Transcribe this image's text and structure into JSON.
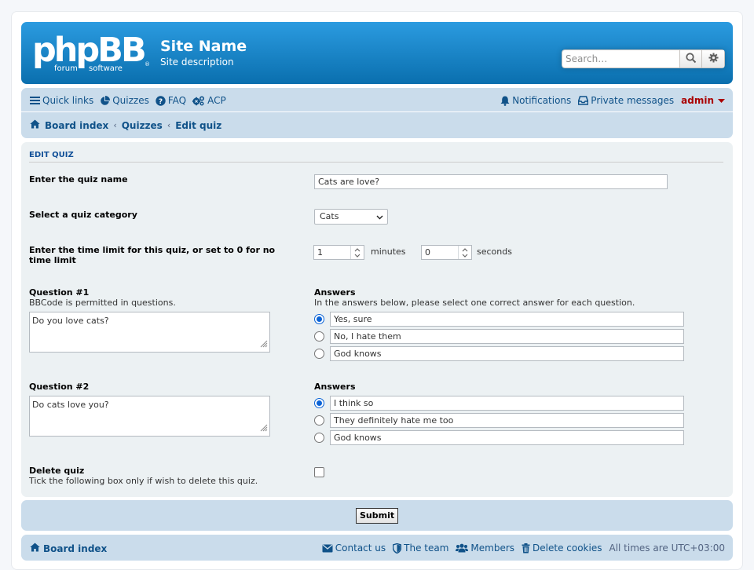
{
  "header": {
    "logo": {
      "main": "phpBB",
      "sub_left": "forum",
      "sub_right": "software"
    },
    "site_name": "Site Name",
    "site_description": "Site description",
    "search": {
      "placeholder": "Search…"
    }
  },
  "nav": {
    "quick_links": "Quick links",
    "quizzes": "Quizzes",
    "faq": "FAQ",
    "acp": "ACP",
    "notifications": "Notifications",
    "private_messages": "Private messages",
    "user": "admin"
  },
  "breadcrumbs": [
    "Board index",
    "Quizzes",
    "Edit quiz"
  ],
  "form": {
    "section_title": "EDIT QUIZ",
    "quiz_name_label": "Enter the quiz name",
    "quiz_name_value": "Cats are love?",
    "category_label": "Select a quiz category",
    "category_value": "Cats",
    "time_limit_label": "Enter the time limit for this quiz, or set to 0 for no time limit",
    "minutes_value": "1",
    "minutes_label": "minutes",
    "seconds_value": "0",
    "seconds_label": "seconds",
    "questions": [
      {
        "label": "Question #1",
        "hint": "BBCode is permitted in questions.",
        "text": "Do you love cats?",
        "answers_label": "Answers",
        "answers_hint": "In the answers below, please select one correct answer for each question.",
        "answers": [
          "Yes, sure",
          "No, I hate them",
          "God knows"
        ],
        "correct": 0
      },
      {
        "label": "Question #2",
        "text": "Do cats love you?",
        "answers_label": "Answers",
        "answers": [
          "I think so",
          "They definitely hate me too",
          "God knows"
        ],
        "correct": 0
      }
    ],
    "delete_label": "Delete quiz",
    "delete_hint": "Tick the following box only if wish to delete this quiz.",
    "submit_label": "Submit"
  },
  "footer": {
    "board_index": "Board index",
    "contact_us": "Contact us",
    "the_team": "The team",
    "members": "Members",
    "delete_cookies": "Delete cookies",
    "timezone": "All times are UTC+03:00"
  },
  "colors": {
    "header_blue": "#0a6fae",
    "nav_bg": "#cadceb",
    "link": "#105289",
    "admin_red": "#aa0000",
    "panel_bg": "#ecf1f3"
  }
}
